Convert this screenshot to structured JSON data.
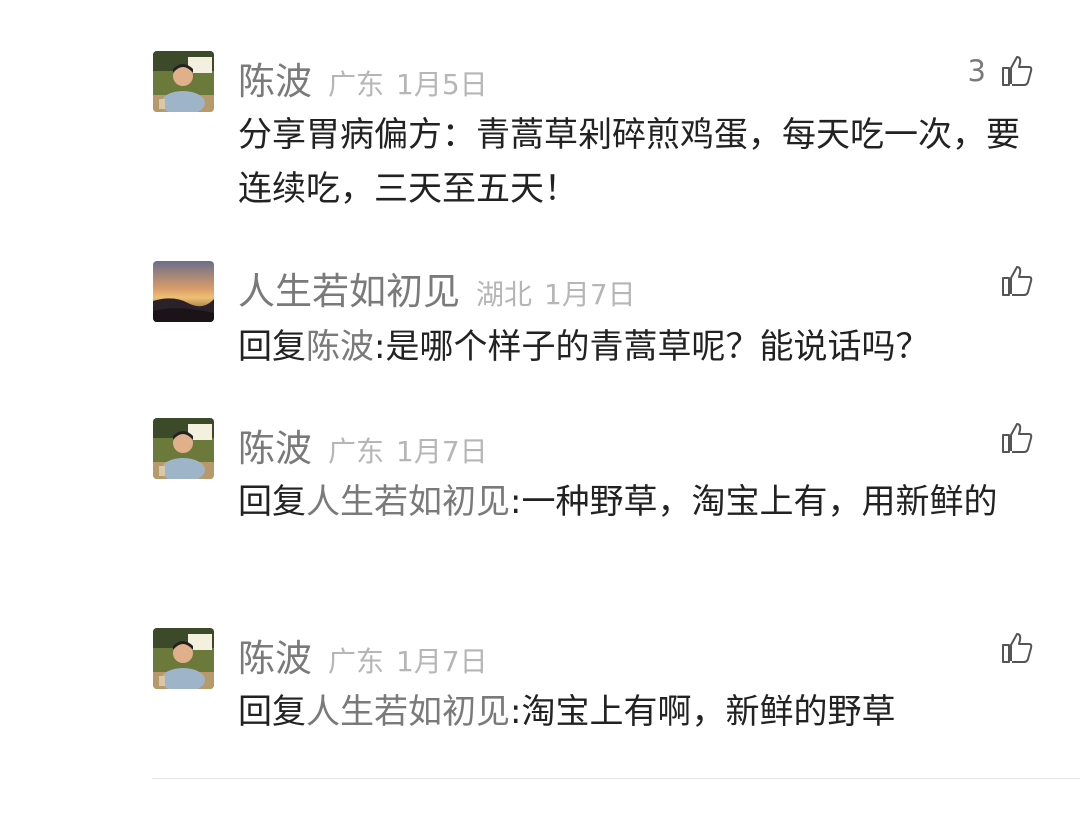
{
  "comments": [
    {
      "name": "陈波",
      "region": "广东",
      "date": "1月5日",
      "likes": "3",
      "text": "分享胃病偏方：青蒿草剁碎煎鸡蛋，每天吃一次，要连续吃，三天至五天！"
    },
    {
      "name": "人生若如初见",
      "region": "湖北",
      "date": "1月7日",
      "likes": "",
      "reply_prefix": "回复",
      "reply_to": "陈波",
      "text": ":是哪个样子的青蒿草呢？能说话吗？"
    },
    {
      "name": "陈波",
      "region": "广东",
      "date": "1月7日",
      "likes": "",
      "reply_prefix": "回复",
      "reply_to": "人生若如初见",
      "text": ":一种野草，淘宝上有，用新鲜的"
    },
    {
      "name": "陈波",
      "region": "广东",
      "date": "1月7日",
      "likes": "",
      "reply_prefix": "回复",
      "reply_to": "人生若如初见",
      "text": ":淘宝上有啊，新鲜的野草"
    }
  ],
  "icons": {
    "like": "thumbs-up-icon",
    "avatar_person": "person-photo",
    "avatar_sunset": "sunset-photo"
  },
  "colors": {
    "name": "#7a7a7a",
    "meta": "#b6b6b6",
    "body": "#222222"
  }
}
